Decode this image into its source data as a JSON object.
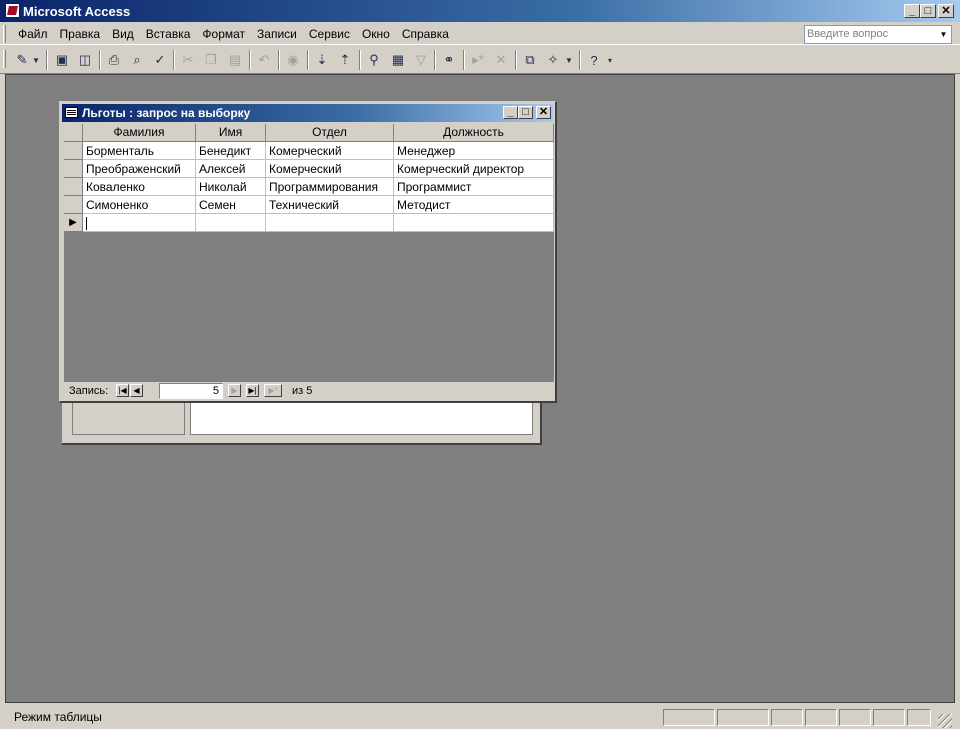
{
  "app": {
    "title": "Microsoft Access"
  },
  "menu": [
    "Файл",
    "Правка",
    "Вид",
    "Вставка",
    "Формат",
    "Записи",
    "Сервис",
    "Окно",
    "Справка"
  ],
  "ask": {
    "placeholder": "Введите вопрос"
  },
  "toolbar_icons": [
    "view-design-icon",
    "save-icon",
    "search-file-icon",
    "print-icon",
    "print-preview-icon",
    "spelling-icon",
    "cut-icon",
    "copy-icon",
    "paste-icon",
    "undo-icon",
    "hyperlink-icon",
    "sort-ascending-icon",
    "sort-descending-icon",
    "filter-by-selection-icon",
    "filter-by-form-icon",
    "apply-filter-icon",
    "find-icon",
    "new-record-icon",
    "delete-record-icon",
    "database-window-icon",
    "new-object-icon",
    "help-icon"
  ],
  "query_window": {
    "title": "Льготы : запрос на выборку",
    "columns": [
      "Фамилия",
      "Имя",
      "Отдел",
      "Должность"
    ],
    "rows": [
      [
        "Борменталь",
        "Бенедикт",
        "Комерческий",
        "Менеджер"
      ],
      [
        "Преображенский",
        "Алексей",
        "Комерческий",
        "Комерческий директор"
      ],
      [
        "Коваленко",
        "Николай",
        "Программирования",
        "Программист"
      ],
      [
        "Симоненко",
        "Семен",
        "Технический",
        "Методист"
      ]
    ],
    "current_row_marker": "▶",
    "nav": {
      "label": "Запись:",
      "current": "5",
      "of_text": "из 5"
    }
  },
  "status": {
    "text": "Режим таблицы"
  },
  "colors": {
    "title_start": "#0a246a",
    "title_end": "#a6caf0",
    "mdi_background": "#808080",
    "face": "#d4d0c8"
  }
}
